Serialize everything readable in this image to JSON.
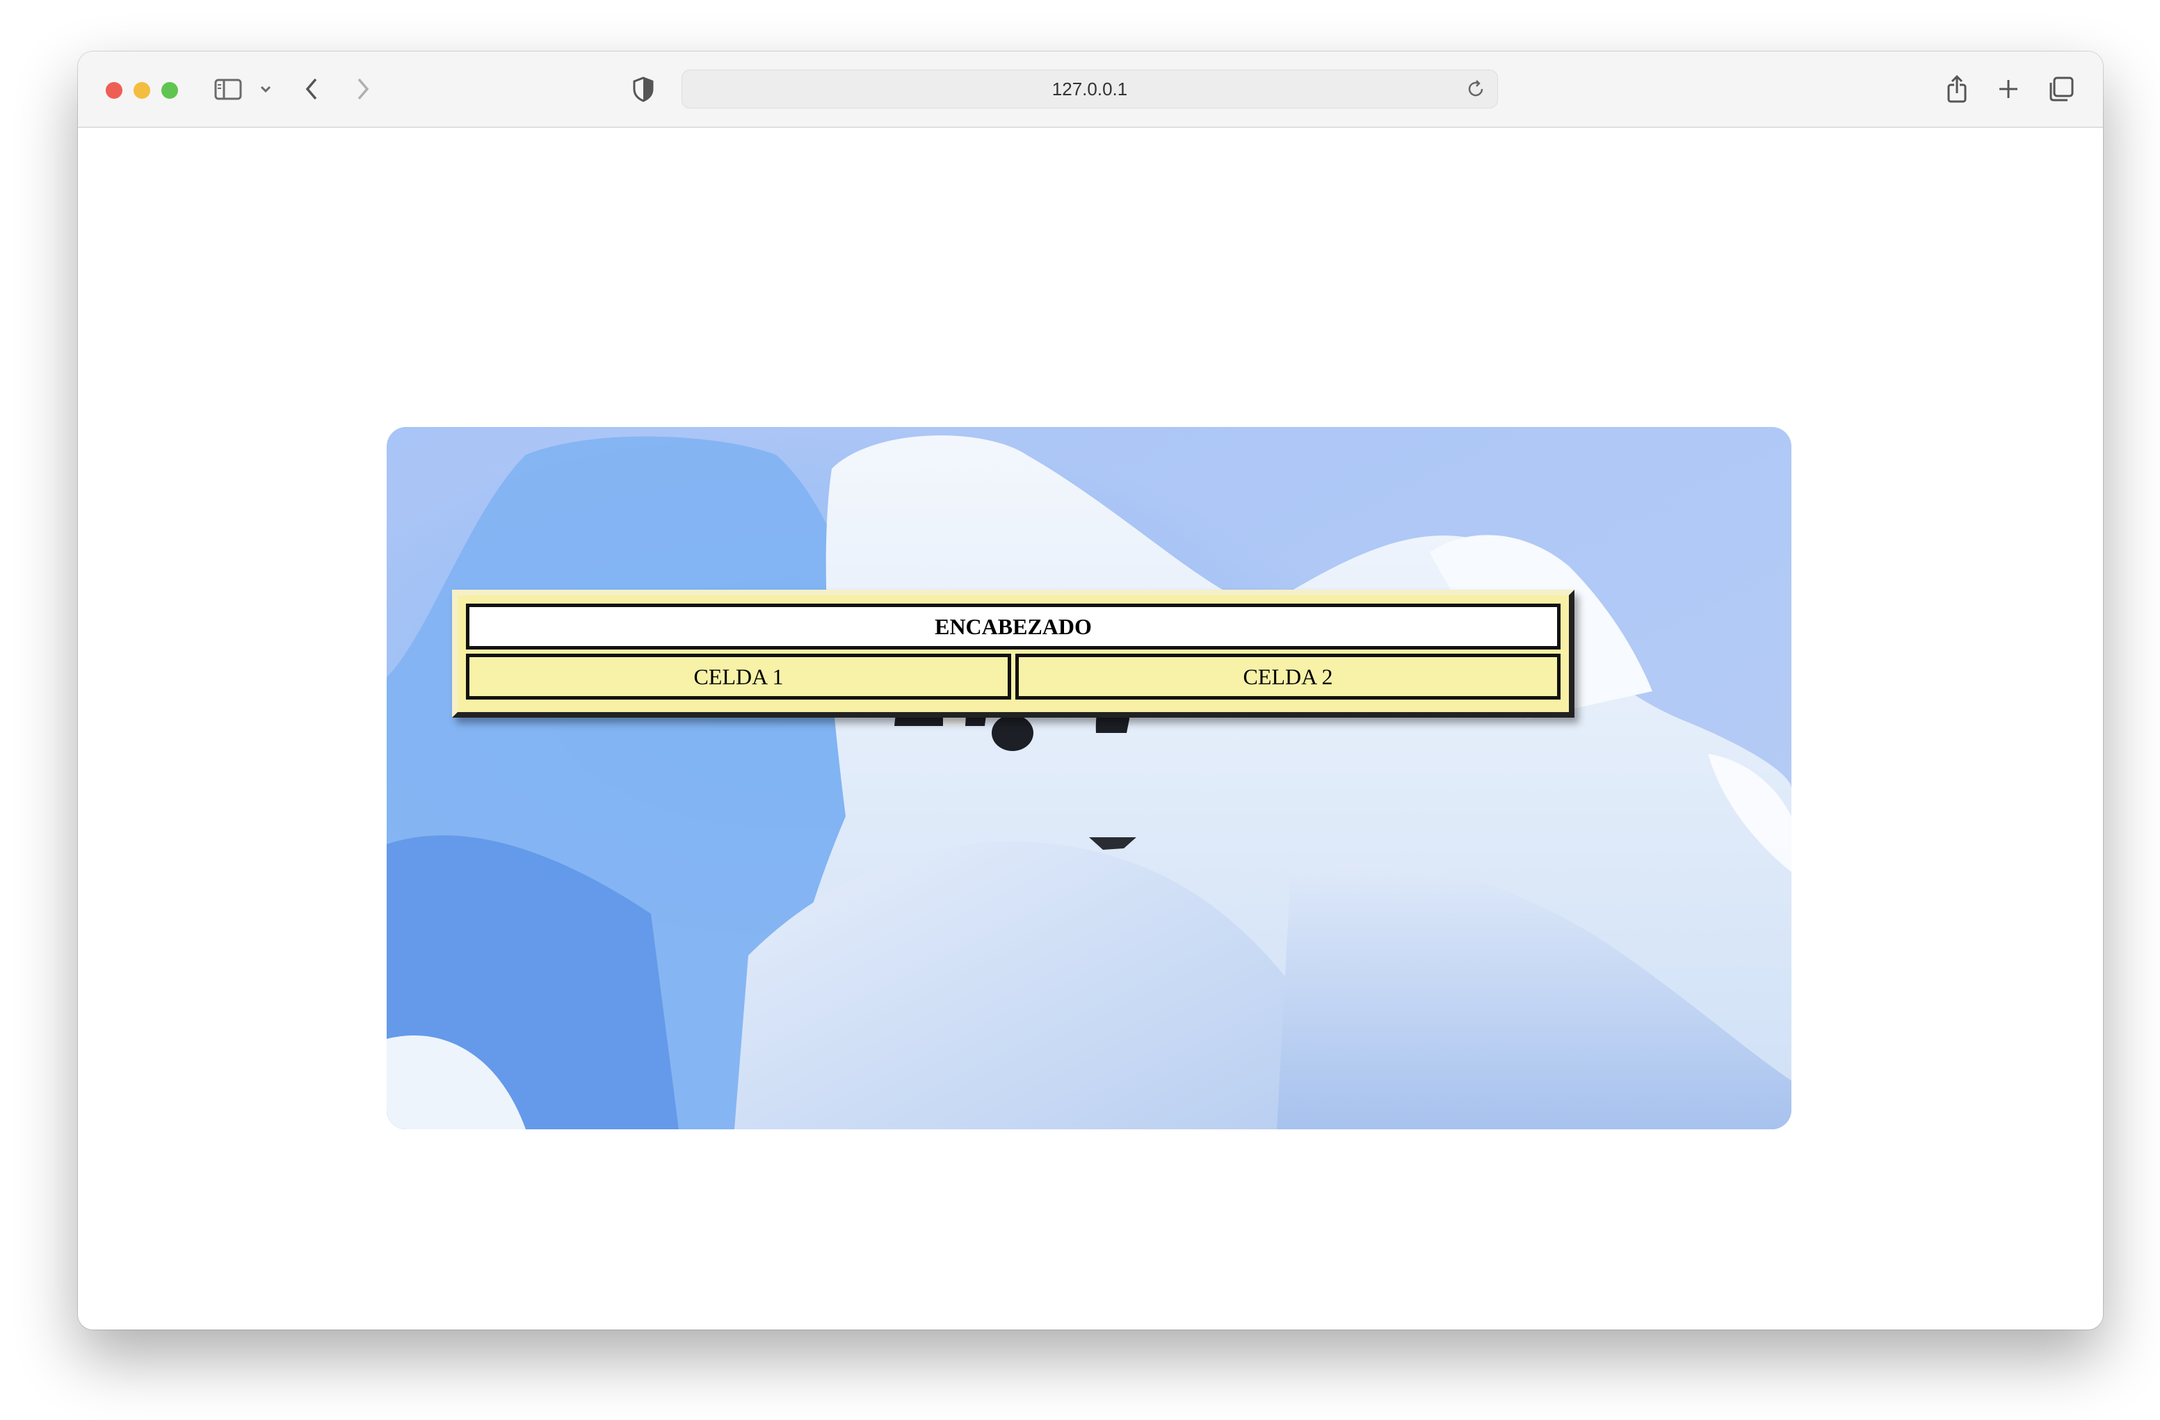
{
  "browser": {
    "url": "127.0.0.1",
    "icons": [
      "sidebar-icon",
      "chevron-down-icon",
      "back-icon",
      "forward-icon",
      "shield-icon",
      "reload-icon",
      "share-icon",
      "plus-icon",
      "tabs-icon"
    ]
  },
  "page": {
    "background_image": "icebergs-with-penguins",
    "table": {
      "header": "ENCABEZADO",
      "cells": [
        "CELDA 1",
        "CELDA 2"
      ],
      "colors": {
        "border": "#111111",
        "header_bg": "#ffffff",
        "cell_bg": "#f7f2a8"
      }
    }
  }
}
